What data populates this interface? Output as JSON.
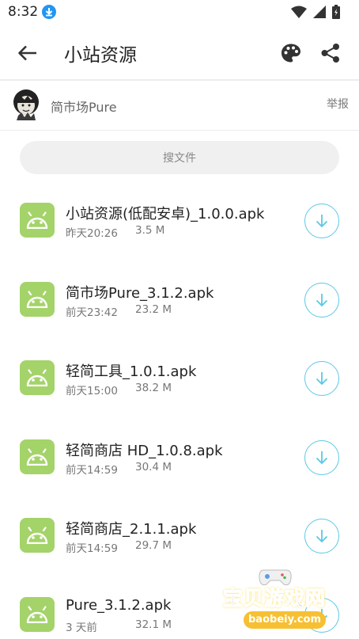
{
  "status_bar": {
    "time": "8:32"
  },
  "app_bar": {
    "title": "小站资源"
  },
  "owner": {
    "name": "简市场Pure",
    "report_label": "举报"
  },
  "search": {
    "placeholder": "搜文件"
  },
  "files": [
    {
      "name": "小站资源(低配安卓)_1.0.0.apk",
      "time": "昨天20:26",
      "size": "3.5 M"
    },
    {
      "name": "简市场Pure_3.1.2.apk",
      "time": "前天23:42",
      "size": "23.2 M"
    },
    {
      "name": "轻简工具_1.0.1.apk",
      "time": "前天15:00",
      "size": "38.2 M"
    },
    {
      "name": "轻简商店 HD_1.0.8.apk",
      "time": "前天14:59",
      "size": "30.4 M"
    },
    {
      "name": "轻简商店_2.1.1.apk",
      "time": "前天14:59",
      "size": "29.7 M"
    },
    {
      "name": "Pure_3.1.2.apk",
      "time": "3 天前",
      "size": "32.1 M"
    }
  ],
  "watermark": {
    "title": "宝贝游戏网",
    "url": "baobeiy.com"
  },
  "colors": {
    "apk_icon": "#a4d36a",
    "download_accent": "#5cc8e6",
    "status_download": "#2196f3"
  }
}
